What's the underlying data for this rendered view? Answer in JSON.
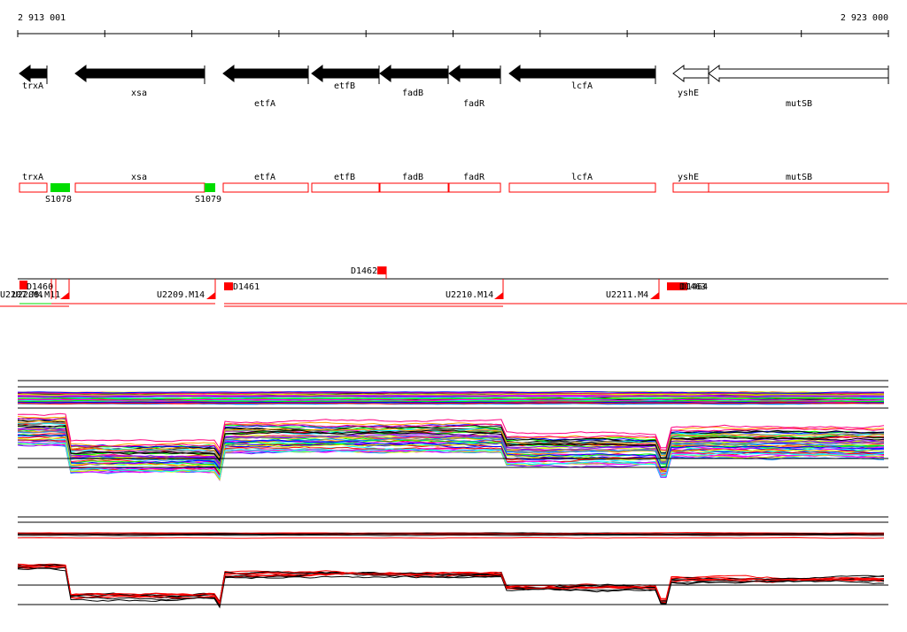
{
  "ruler": {
    "start_label": "2 913 001",
    "end_label": "2 923 000"
  },
  "genes": [
    {
      "name": "trxA",
      "strand": "-",
      "filled": true
    },
    {
      "name": "xsa",
      "strand": "-",
      "filled": true
    },
    {
      "name": "etfA",
      "strand": "-",
      "filled": true
    },
    {
      "name": "etfB",
      "strand": "-",
      "filled": true
    },
    {
      "name": "fadB",
      "strand": "-",
      "filled": true
    },
    {
      "name": "fadR",
      "strand": "-",
      "filled": true
    },
    {
      "name": "lcfA",
      "strand": "-",
      "filled": true
    },
    {
      "name": "yshE",
      "strand": "-",
      "filled": false
    },
    {
      "name": "mutSB",
      "strand": "-",
      "filled": false
    }
  ],
  "features": [
    {
      "name": "S1078"
    },
    {
      "name": "S1079"
    }
  ],
  "segments": {
    "d_labels": [
      "D1462",
      "D1460",
      "D1461",
      "D1463",
      "D1464"
    ],
    "u_labels": [
      "U2207.M4",
      "U2208.M11",
      "U2209.M14",
      "U2210.M14",
      "U2211.M4"
    ]
  },
  "colors": {
    "accent": "#ff0000",
    "feature": "#00dd00",
    "gene": "#000000"
  }
}
